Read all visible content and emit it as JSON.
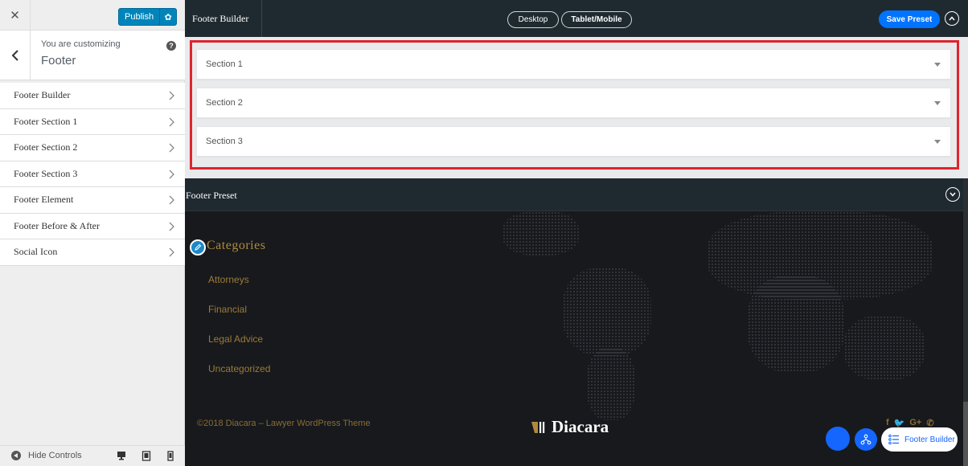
{
  "sidebar": {
    "publish_label": "Publish",
    "customizing_label": "You are customizing",
    "section_title": "Footer",
    "items": [
      {
        "label": "Footer Builder"
      },
      {
        "label": "Footer Section 1"
      },
      {
        "label": "Footer Section 2"
      },
      {
        "label": "Footer Section 3"
      },
      {
        "label": "Footer Element"
      },
      {
        "label": "Footer Before & After"
      },
      {
        "label": "Social Icon"
      }
    ],
    "hide_controls_label": "Hide Controls"
  },
  "builder": {
    "title": "Footer Builder",
    "device_desktop": "Desktop",
    "device_tablet": "Tablet/Mobile",
    "save_preset_label": "Save Preset",
    "sections": [
      {
        "label": "Section 1"
      },
      {
        "label": "Section 2"
      },
      {
        "label": "Section 3"
      }
    ]
  },
  "preset": {
    "title": "Footer Preset"
  },
  "footer": {
    "categories_title": "Categories",
    "categories": [
      "Attorneys",
      "Financial",
      "Legal Advice",
      "Uncategorized"
    ],
    "copyright": "©2018 Diacara – Lawyer WordPress Theme",
    "brand_name": "Diacara",
    "socials": [
      "f",
      "🐦",
      "G+",
      "✆"
    ]
  },
  "floating": {
    "footer_builder_label": "Footer Builder"
  },
  "colors": {
    "accent": "#0073ff",
    "publish": "#0085ba",
    "highlight_border": "#e0242c",
    "footer_gold": "#b08a3e",
    "dark_bar": "#1f2a30"
  }
}
